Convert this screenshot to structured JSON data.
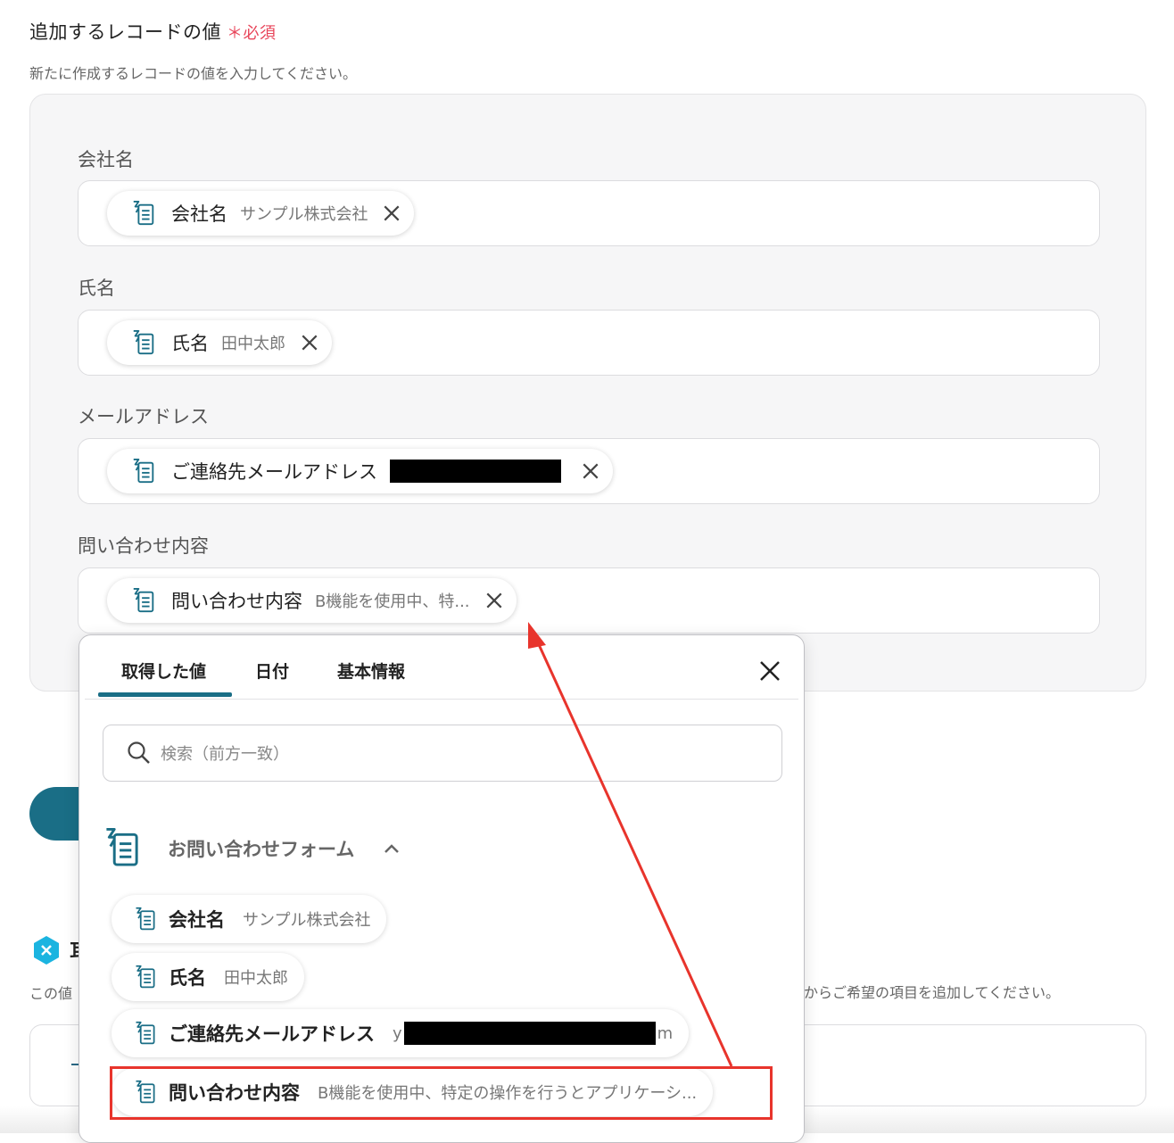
{
  "section": {
    "title": "追加するレコードの値",
    "required_mark": "＊",
    "required_label": "必須",
    "description": "新たに作成するレコードの値を入力してください。"
  },
  "fields": [
    {
      "label": "会社名",
      "chip": {
        "name": "会社名",
        "value": "サンプル株式会社"
      }
    },
    {
      "label": "氏名",
      "chip": {
        "name": "氏名",
        "value": "田中太郎"
      }
    },
    {
      "label": "メールアドレス",
      "chip": {
        "name": "ご連絡先メールアドレス",
        "value": ""
      }
    },
    {
      "label": "問い合わせ内容",
      "chip": {
        "name": "問い合わせ内容",
        "value": "B機能を使用中、特..."
      }
    }
  ],
  "popup": {
    "tabs": [
      "取得した値",
      "日付",
      "基本情報"
    ],
    "active_tab": "取得した値",
    "search_placeholder": "検索（前方一致）",
    "group": {
      "label": "お問い合わせフォーム",
      "expanded": true
    },
    "options": [
      {
        "name": "会社名",
        "value": "サンプル株式会社"
      },
      {
        "name": "氏名",
        "value": "田中太郎"
      },
      {
        "name": "ご連絡先メールアドレス",
        "value_prefix": "y",
        "value_suffix": "m"
      },
      {
        "name": "問い合わせ内容",
        "value": "B機能を使用中、特定の操作を行うとアプリケーシ..."
      }
    ]
  },
  "section2": {
    "title_partial": "耳",
    "desc_left": "この値",
    "desc_right": "からご希望の項目を追加してください。"
  },
  "colors": {
    "accent": "#1a6e86",
    "required": "#e8455a",
    "annotation": "#e8342c",
    "redaction": "#000000"
  },
  "icons": {
    "form_icon": "form-icon",
    "remove": "close-icon",
    "search": "search-icon",
    "expand": "chevron-up-icon",
    "section2": "x-badge-icon"
  }
}
